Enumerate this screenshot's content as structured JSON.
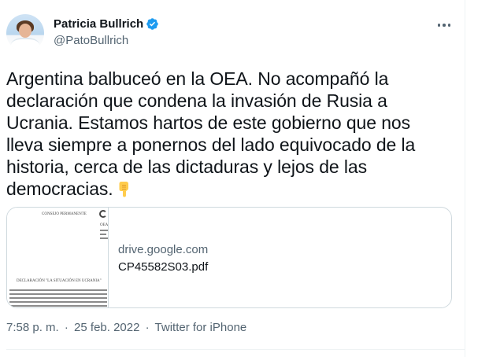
{
  "author": {
    "display_name": "Patricia Bullrich",
    "handle": "@PatoBullrich",
    "verified": true,
    "avatar_icon": "profile-photo"
  },
  "menu": {
    "icon": "more-horizontal-icon"
  },
  "tweet": {
    "text": "Argentina balbuceó en la OEA. No acompañó la declaración que condena la invasión de Rusia a Ucrania. Estamos hartos de este gobierno que nos lleva siempre a ponernos del lado equivocado de la historia, cerca de las dictaduras y lejos de las democracias.",
    "emoji": "👇"
  },
  "card": {
    "domain": "drive.google.com",
    "title": "CP45582S03.pdf",
    "thumbnail_header": "CONSEJO PERMANENTE",
    "thumbnail_side": "OEA",
    "thumbnail_heading": "DECLARACIÓN \"LA SITUACIÓN EN UCRANIA\""
  },
  "meta": {
    "time": "7:58 p. m.",
    "separator": "·",
    "date": "25 feb. 2022",
    "source": "Twitter for iPhone"
  },
  "colors": {
    "text_primary": "#0f1419",
    "text_secondary": "#536471",
    "verified_blue": "#1d9bf0",
    "border": "#cfd9de"
  }
}
